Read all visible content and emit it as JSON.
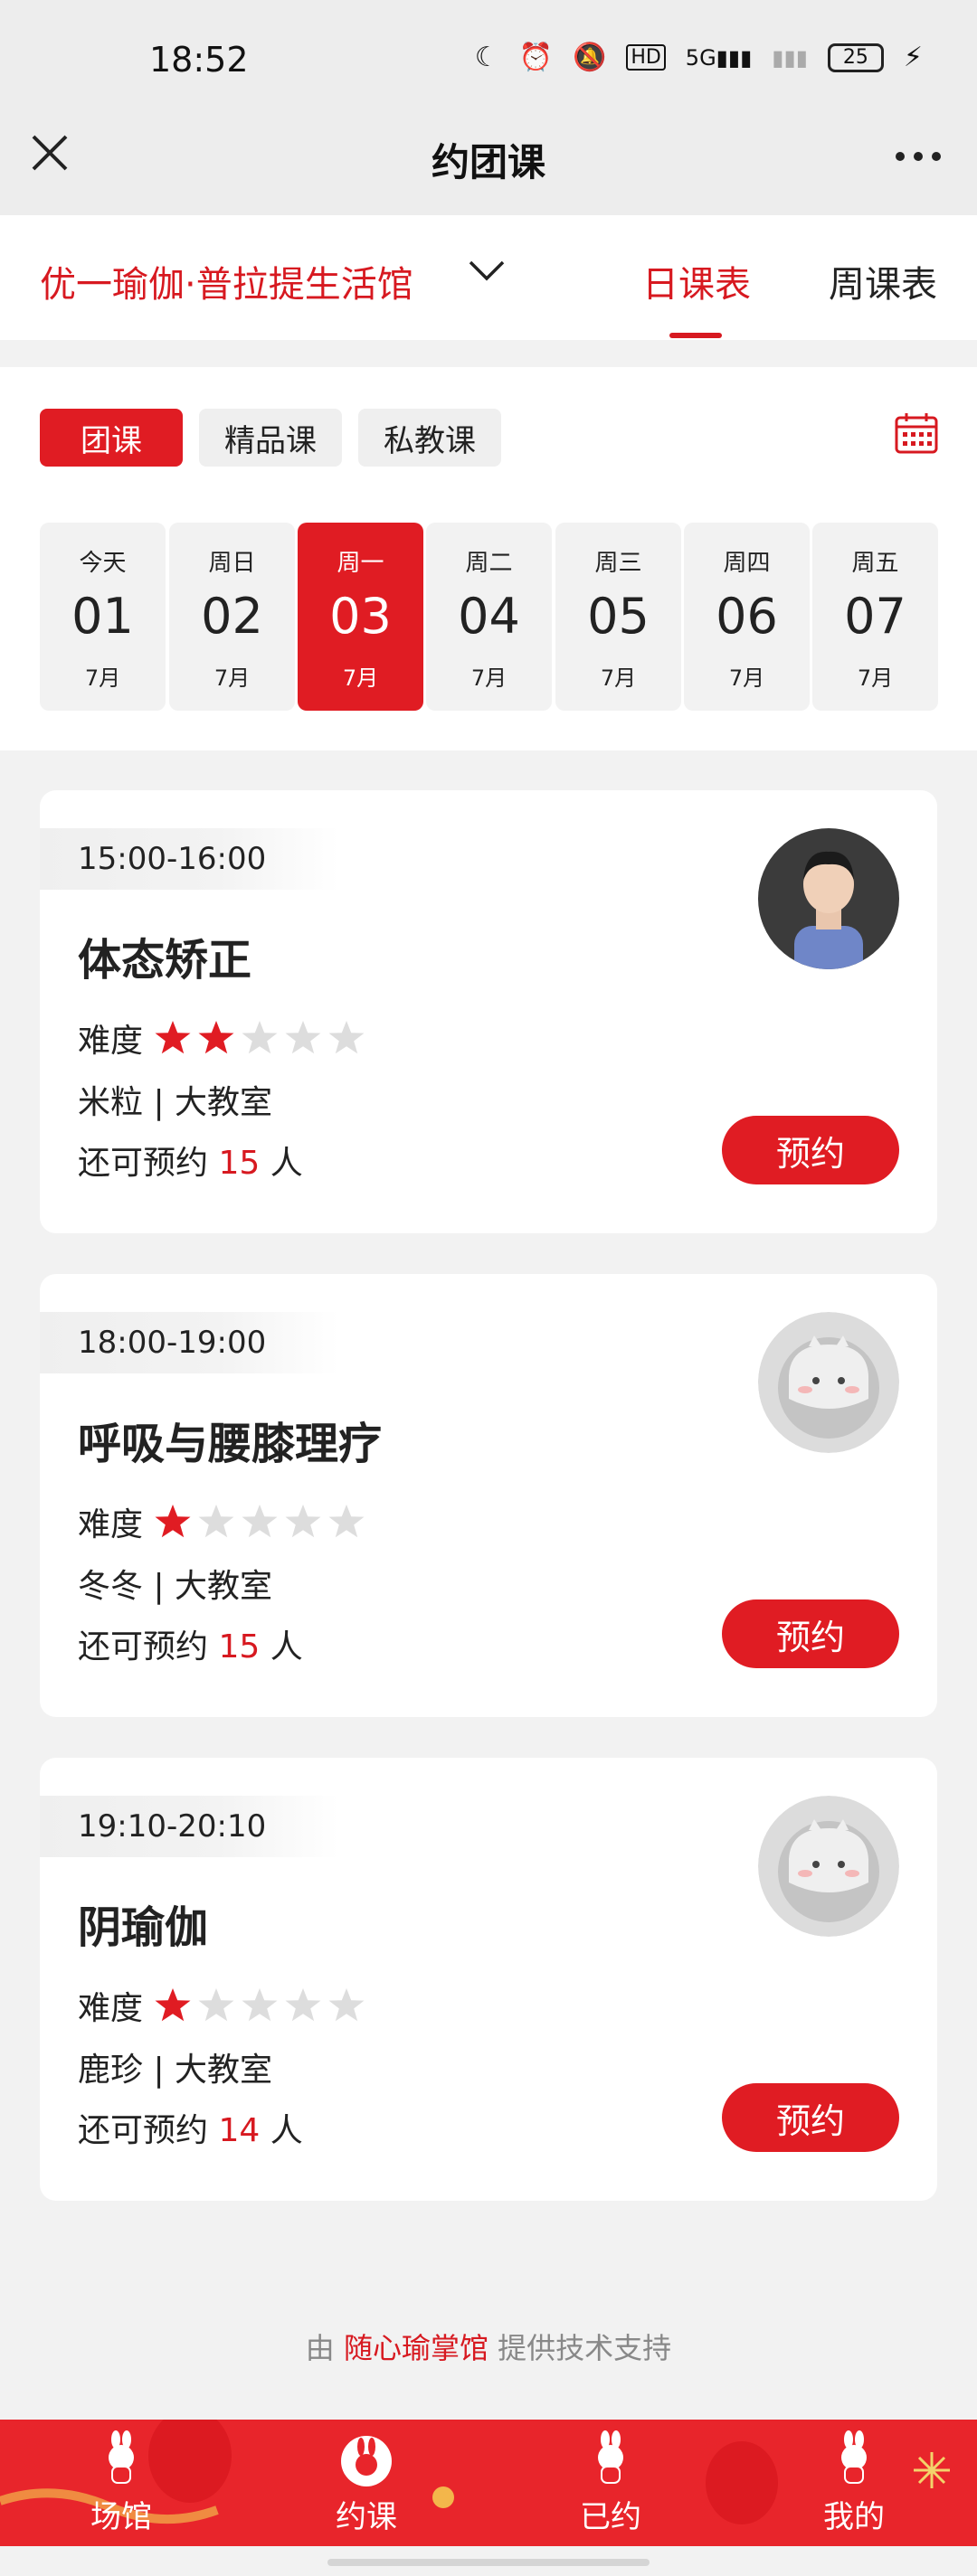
{
  "status_bar": {
    "time": "18:52",
    "icons": [
      "moon-icon",
      "alarm-icon",
      "mute-icon",
      "hd-icon",
      "signal-5g-icon",
      "signal-icon"
    ],
    "battery": "25"
  },
  "nav": {
    "title": "约团课"
  },
  "venue": {
    "name": "优一瑜伽·普拉提生活馆",
    "tabs": [
      "日课表",
      "周课表"
    ],
    "active_tab": "日课表"
  },
  "filters": {
    "chips": [
      "团课",
      "精品课",
      "私教课"
    ],
    "active_chip": "团课"
  },
  "dates": [
    {
      "week": "今天",
      "day": "01",
      "month": "7月",
      "active": false
    },
    {
      "week": "周日",
      "day": "02",
      "month": "7月",
      "active": false
    },
    {
      "week": "周一",
      "day": "03",
      "month": "7月",
      "active": true
    },
    {
      "week": "周二",
      "day": "04",
      "month": "7月",
      "active": false
    },
    {
      "week": "周三",
      "day": "05",
      "month": "7月",
      "active": false
    },
    {
      "week": "周四",
      "day": "06",
      "month": "7月",
      "active": false
    },
    {
      "week": "周五",
      "day": "07",
      "month": "7月",
      "active": false
    }
  ],
  "courses": [
    {
      "time": "15:00-16:00",
      "title": "体态矫正",
      "difficulty_label": "难度",
      "difficulty": 2,
      "difficulty_max": 5,
      "teacher": "米粒",
      "room": "大教室",
      "teacher_room": "米粒 | 大教室",
      "avail_prefix": "还可预约",
      "avail_count": "15",
      "avail_suffix": "人",
      "book_label": "预约",
      "avatar": "photo"
    },
    {
      "time": "18:00-19:00",
      "title": "呼吸与腰膝理疗",
      "difficulty_label": "难度",
      "difficulty": 1,
      "difficulty_max": 5,
      "teacher": "冬冬",
      "room": "大教室",
      "teacher_room": "冬冬 | 大教室",
      "avail_prefix": "还可预约",
      "avail_count": "15",
      "avail_suffix": "人",
      "book_label": "预约",
      "avatar": "placeholder"
    },
    {
      "time": "19:10-20:10",
      "title": "阴瑜伽",
      "difficulty_label": "难度",
      "difficulty": 1,
      "difficulty_max": 5,
      "teacher": "鹿珍",
      "room": "大教室",
      "teacher_room": "鹿珍 | 大教室",
      "avail_prefix": "还可预约",
      "avail_count": "14",
      "avail_suffix": "人",
      "book_label": "预约",
      "avatar": "placeholder"
    }
  ],
  "footer": {
    "prefix": "由",
    "brand": "随心瑜掌馆",
    "suffix": "提供技术支持"
  },
  "tabbar": {
    "items": [
      "场馆",
      "约课",
      "已约",
      "我的"
    ],
    "active": "约课"
  },
  "colors": {
    "accent": "#e01c23",
    "text": "#222222",
    "star_off": "#dddddd",
    "background": "#f2f2f2"
  }
}
